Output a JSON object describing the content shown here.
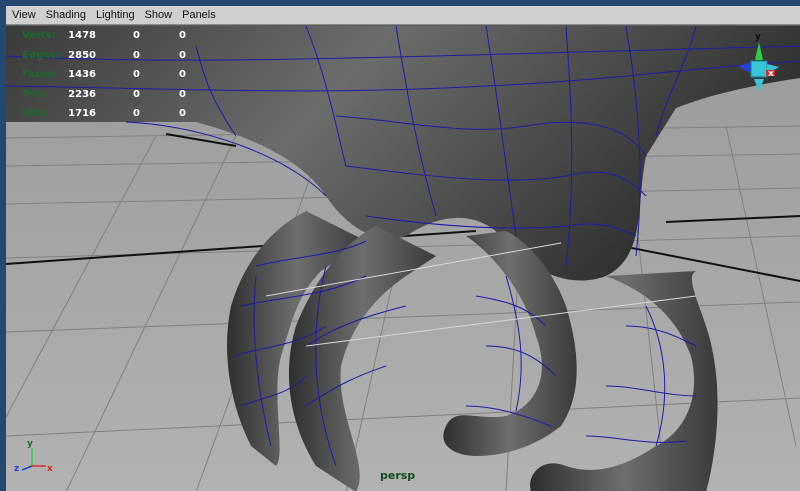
{
  "menubar": {
    "items": [
      "View",
      "Shading",
      "Lighting",
      "Show",
      "Panels"
    ]
  },
  "hud": {
    "rows": [
      {
        "label": "Verts:",
        "values": [
          "1478",
          "0",
          "0"
        ]
      },
      {
        "label": "Edges:",
        "values": [
          "2850",
          "0",
          "0"
        ]
      },
      {
        "label": "Faces:",
        "values": [
          "1436",
          "0",
          "0"
        ]
      },
      {
        "label": "Tris:",
        "values": [
          "2236",
          "0",
          "0"
        ]
      },
      {
        "label": "UVs:",
        "values": [
          "1716",
          "0",
          "0"
        ]
      }
    ]
  },
  "viewport": {
    "camera_label": "persp",
    "view_cube": {
      "axis_y": "y",
      "axis_x": "x"
    },
    "axis_indicator": {
      "y": "y",
      "z": "z",
      "x": "x"
    }
  },
  "colors": {
    "viewport_bg": "#a9a9a9",
    "mesh": "#4a4a4a",
    "wire": "#1c1ca8",
    "hud_label": "#1b6b2a",
    "frame": "#24486f"
  }
}
